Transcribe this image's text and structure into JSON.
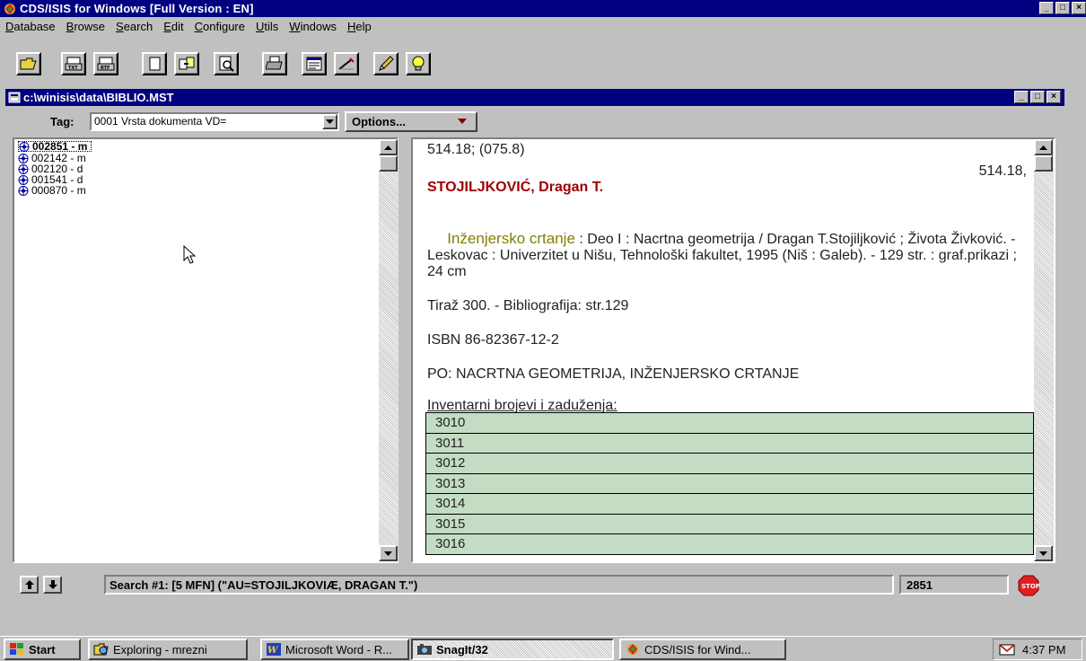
{
  "app": {
    "title": "CDS/ISIS for Windows [Full Version : EN]"
  },
  "menubar": [
    {
      "label": "Database",
      "key": "D",
      "rest": "atabase"
    },
    {
      "label": "Browse",
      "key": "B",
      "rest": "rowse"
    },
    {
      "label": "Search",
      "key": "S",
      "rest": "earch"
    },
    {
      "label": "Edit",
      "key": "E",
      "rest": "dit"
    },
    {
      "label": "Configure",
      "key": "C",
      "rest": "onfigure"
    },
    {
      "label": "Utils",
      "key": "U",
      "rest": "tils"
    },
    {
      "label": "Windows",
      "key": "W",
      "rest": "indows"
    },
    {
      "label": "Help",
      "key": "H",
      "rest": "elp"
    }
  ],
  "toolbar": {
    "icons": [
      "open-folder-icon",
      "print-txt-icon",
      "print-rtf-icon",
      "new-record-icon",
      "copy-record-icon",
      "preview-icon",
      "printer-icon",
      "form-icon",
      "edit-pen-icon",
      "pencil-icon",
      "lightbulb-icon"
    ]
  },
  "child": {
    "title": "c:\\winisis\\data\\BIBLIO.MST",
    "tag_label": "Tag:",
    "tag_value": "0001 Vrsta dokumenta  VD=",
    "options_label": "Options..."
  },
  "list": {
    "items": [
      {
        "label": "002851 - m",
        "selected": true
      },
      {
        "label": "002142 - m",
        "selected": false
      },
      {
        "label": "002120 - d",
        "selected": false
      },
      {
        "label": "001541 - d",
        "selected": false
      },
      {
        "label": "000870 - m",
        "selected": false
      }
    ]
  },
  "record": {
    "class_top": "514.18; (075.8)",
    "class_right": "514.18,",
    "author": "STOJILJKOVIĆ, Dragan T.",
    "title_part": "Inženjersko crtanje",
    "desc_rest": " : Deo I : Nacrtna geometrija / Dragan T.Stojiljković ; Života Živković. - Leskovac : Univerzitet u Nišu, Tehnološki fakultet, 1995 (Niš : Galeb). - 129 str. : graf.prikazi ; 24 cm",
    "tiraz": "Tiraž 300. - Bibliografija: str.129",
    "isbn": "ISBN 86-82367-12-2",
    "po": "PO:  NACRTNA GEOMETRIJA, INŽENJERSKO CRTANJE",
    "inv_label": "Inventarni brojevi i zaduženja:",
    "inventory": [
      "3010",
      "3011",
      "3012",
      "3013",
      "3014",
      "3015",
      "3016"
    ]
  },
  "status": {
    "search_text": "Search #1: [5 MFN] (\"AU=STOJILJKOVIÆ, DRAGAN T.\")",
    "mfn": "2851"
  },
  "taskbar": {
    "start": "Start",
    "tasks": [
      {
        "label": "Exploring - mrezni",
        "icon": "explorer-icon",
        "active": false
      },
      {
        "label": "Microsoft Word - R...",
        "icon": "word-icon",
        "active": false
      },
      {
        "label": "SnagIt/32",
        "icon": "snagit-icon",
        "active": true
      },
      {
        "label": "CDS/ISIS for Wind...",
        "icon": "cdsisis-icon",
        "active": false
      }
    ],
    "clock": "4:37 PM"
  },
  "colors": {
    "title_bar": "#000080",
    "author": "#a00000",
    "title_part": "#808000",
    "inventory_row": "#c4dcc4"
  }
}
